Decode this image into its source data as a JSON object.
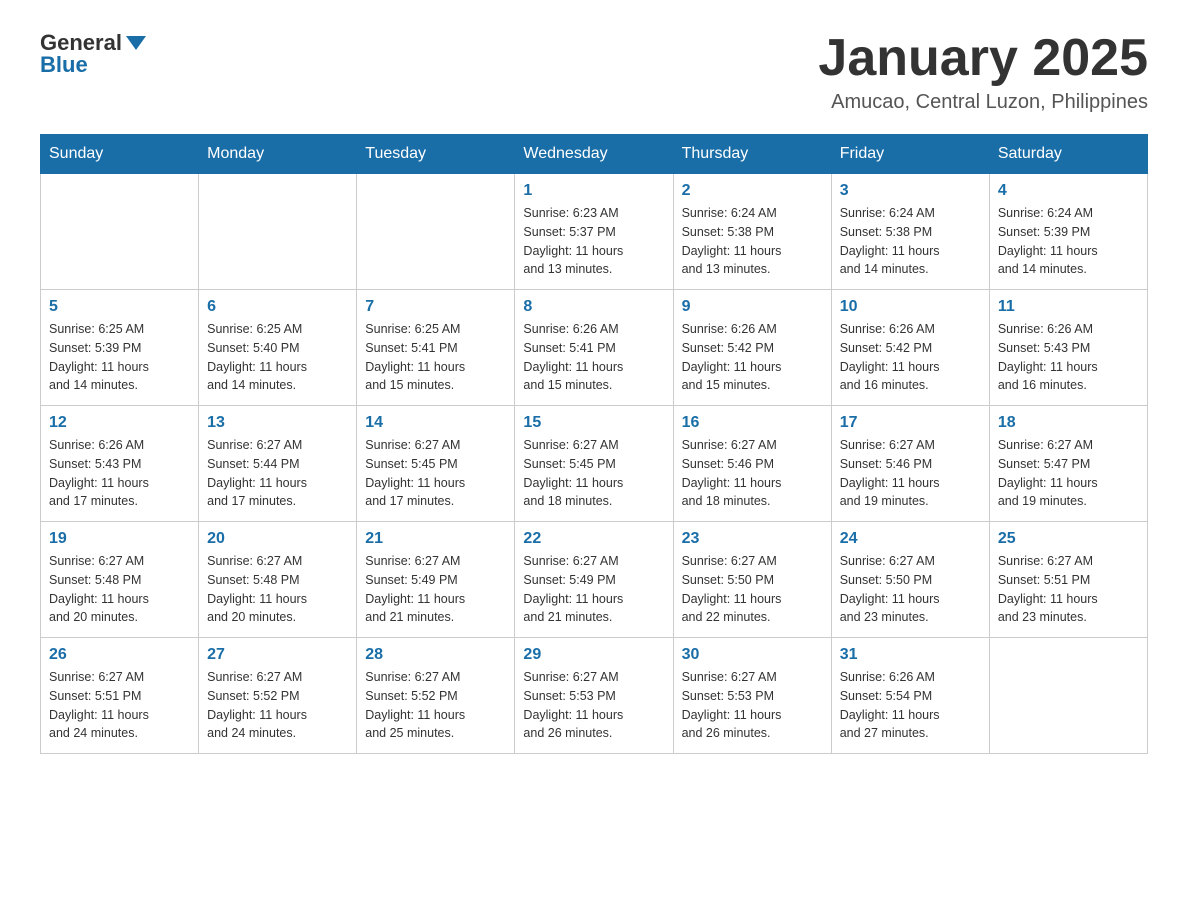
{
  "header": {
    "logo_general": "General",
    "logo_blue": "Blue",
    "month_title": "January 2025",
    "location": "Amucao, Central Luzon, Philippines"
  },
  "days_of_week": [
    "Sunday",
    "Monday",
    "Tuesday",
    "Wednesday",
    "Thursday",
    "Friday",
    "Saturday"
  ],
  "weeks": [
    [
      {
        "day": "",
        "info": ""
      },
      {
        "day": "",
        "info": ""
      },
      {
        "day": "",
        "info": ""
      },
      {
        "day": "1",
        "info": "Sunrise: 6:23 AM\nSunset: 5:37 PM\nDaylight: 11 hours\nand 13 minutes."
      },
      {
        "day": "2",
        "info": "Sunrise: 6:24 AM\nSunset: 5:38 PM\nDaylight: 11 hours\nand 13 minutes."
      },
      {
        "day": "3",
        "info": "Sunrise: 6:24 AM\nSunset: 5:38 PM\nDaylight: 11 hours\nand 14 minutes."
      },
      {
        "day": "4",
        "info": "Sunrise: 6:24 AM\nSunset: 5:39 PM\nDaylight: 11 hours\nand 14 minutes."
      }
    ],
    [
      {
        "day": "5",
        "info": "Sunrise: 6:25 AM\nSunset: 5:39 PM\nDaylight: 11 hours\nand 14 minutes."
      },
      {
        "day": "6",
        "info": "Sunrise: 6:25 AM\nSunset: 5:40 PM\nDaylight: 11 hours\nand 14 minutes."
      },
      {
        "day": "7",
        "info": "Sunrise: 6:25 AM\nSunset: 5:41 PM\nDaylight: 11 hours\nand 15 minutes."
      },
      {
        "day": "8",
        "info": "Sunrise: 6:26 AM\nSunset: 5:41 PM\nDaylight: 11 hours\nand 15 minutes."
      },
      {
        "day": "9",
        "info": "Sunrise: 6:26 AM\nSunset: 5:42 PM\nDaylight: 11 hours\nand 15 minutes."
      },
      {
        "day": "10",
        "info": "Sunrise: 6:26 AM\nSunset: 5:42 PM\nDaylight: 11 hours\nand 16 minutes."
      },
      {
        "day": "11",
        "info": "Sunrise: 6:26 AM\nSunset: 5:43 PM\nDaylight: 11 hours\nand 16 minutes."
      }
    ],
    [
      {
        "day": "12",
        "info": "Sunrise: 6:26 AM\nSunset: 5:43 PM\nDaylight: 11 hours\nand 17 minutes."
      },
      {
        "day": "13",
        "info": "Sunrise: 6:27 AM\nSunset: 5:44 PM\nDaylight: 11 hours\nand 17 minutes."
      },
      {
        "day": "14",
        "info": "Sunrise: 6:27 AM\nSunset: 5:45 PM\nDaylight: 11 hours\nand 17 minutes."
      },
      {
        "day": "15",
        "info": "Sunrise: 6:27 AM\nSunset: 5:45 PM\nDaylight: 11 hours\nand 18 minutes."
      },
      {
        "day": "16",
        "info": "Sunrise: 6:27 AM\nSunset: 5:46 PM\nDaylight: 11 hours\nand 18 minutes."
      },
      {
        "day": "17",
        "info": "Sunrise: 6:27 AM\nSunset: 5:46 PM\nDaylight: 11 hours\nand 19 minutes."
      },
      {
        "day": "18",
        "info": "Sunrise: 6:27 AM\nSunset: 5:47 PM\nDaylight: 11 hours\nand 19 minutes."
      }
    ],
    [
      {
        "day": "19",
        "info": "Sunrise: 6:27 AM\nSunset: 5:48 PM\nDaylight: 11 hours\nand 20 minutes."
      },
      {
        "day": "20",
        "info": "Sunrise: 6:27 AM\nSunset: 5:48 PM\nDaylight: 11 hours\nand 20 minutes."
      },
      {
        "day": "21",
        "info": "Sunrise: 6:27 AM\nSunset: 5:49 PM\nDaylight: 11 hours\nand 21 minutes."
      },
      {
        "day": "22",
        "info": "Sunrise: 6:27 AM\nSunset: 5:49 PM\nDaylight: 11 hours\nand 21 minutes."
      },
      {
        "day": "23",
        "info": "Sunrise: 6:27 AM\nSunset: 5:50 PM\nDaylight: 11 hours\nand 22 minutes."
      },
      {
        "day": "24",
        "info": "Sunrise: 6:27 AM\nSunset: 5:50 PM\nDaylight: 11 hours\nand 23 minutes."
      },
      {
        "day": "25",
        "info": "Sunrise: 6:27 AM\nSunset: 5:51 PM\nDaylight: 11 hours\nand 23 minutes."
      }
    ],
    [
      {
        "day": "26",
        "info": "Sunrise: 6:27 AM\nSunset: 5:51 PM\nDaylight: 11 hours\nand 24 minutes."
      },
      {
        "day": "27",
        "info": "Sunrise: 6:27 AM\nSunset: 5:52 PM\nDaylight: 11 hours\nand 24 minutes."
      },
      {
        "day": "28",
        "info": "Sunrise: 6:27 AM\nSunset: 5:52 PM\nDaylight: 11 hours\nand 25 minutes."
      },
      {
        "day": "29",
        "info": "Sunrise: 6:27 AM\nSunset: 5:53 PM\nDaylight: 11 hours\nand 26 minutes."
      },
      {
        "day": "30",
        "info": "Sunrise: 6:27 AM\nSunset: 5:53 PM\nDaylight: 11 hours\nand 26 minutes."
      },
      {
        "day": "31",
        "info": "Sunrise: 6:26 AM\nSunset: 5:54 PM\nDaylight: 11 hours\nand 27 minutes."
      },
      {
        "day": "",
        "info": ""
      }
    ]
  ]
}
